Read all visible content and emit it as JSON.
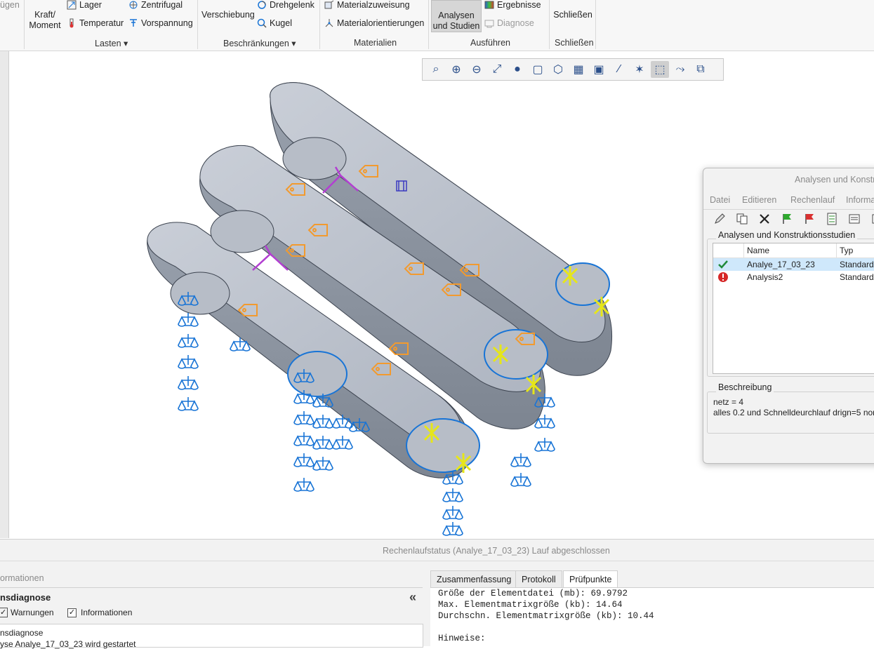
{
  "ribbon": {
    "partial_left_label": "ügen",
    "loads": {
      "force_label": "Kraft/\nMoment",
      "bearing_label": "Lager",
      "temperature_label": "Temperatur",
      "centrifugal_label": "Zentrifugal",
      "preload_label": "Vorspannung",
      "group_label": "Lasten"
    },
    "constraints": {
      "displacement_label": "Verschiebung",
      "pin_label": "Drehgelenk",
      "ball_label": "Kugel",
      "group_label": "Beschränkungen"
    },
    "materials": {
      "assignment_label": "Materialzuweisung",
      "orientations_label": "Materialorientierungen",
      "group_label": "Materialien"
    },
    "run": {
      "analyses_label": "Analysen\nund Studien",
      "results_label": "Ergebnisse",
      "diagnosis_label": "Diagnose",
      "group_label": "Ausführen"
    },
    "close": {
      "close_label": "Schließen",
      "group_label": "Schließen"
    }
  },
  "view_toolbar": {
    "icons": [
      "zoom-window-icon",
      "zoom-in-icon",
      "zoom-out-icon",
      "refit-icon",
      "shading-icon",
      "saved-views-icon",
      "view-manager-icon",
      "perspective-icon",
      "display-style-icon",
      "datum-display-icon",
      "annotation-display-icon",
      "simulation-display-icon",
      "spin-center-icon",
      "appearance-icon"
    ],
    "active_index": 11
  },
  "dialog": {
    "title": "Analysen und Konstr",
    "menu": [
      "Datei",
      "Editieren",
      "Rechenlauf",
      "Informa"
    ],
    "tools": [
      "edit-icon",
      "copy-icon",
      "delete-icon",
      "start-flag-icon",
      "stop-flag-icon",
      "checklist-icon",
      "info-icon",
      "more-icon"
    ],
    "list_legend": "Analysen und Konstruktionsstudien",
    "columns": {
      "name": "Name",
      "type": "Typ"
    },
    "rows": [
      {
        "name": "Analye_17_03_23",
        "type": "Standard/",
        "status": "ok"
      },
      {
        "name": "Analysis2",
        "type": "Standard/",
        "status": "error"
      }
    ],
    "description_legend": "Beschreibung",
    "description_lines": [
      "netz = 4",
      "alles 0.2 und Schnelldeurchlauf drign=5 nor"
    ]
  },
  "bottom": {
    "status_title": "Rechenlaufstatus (Analye_17_03_23) Lauf abgeschlossen",
    "left_header": "ormationen",
    "diag_title": "nsdiagnose",
    "warnings_label": "Warnungen",
    "info_label": "Informationen",
    "diag_line1": "nsdiagnose",
    "diag_line2": "yse Analye_17_03_23 wird gestartet",
    "tabs": [
      "Zusammenfassung",
      "Protokoll",
      "Prüfpunkte"
    ],
    "active_tab": 2,
    "log_lines": [
      "Größe der Elementdatei (mb): 69.9792",
      "Max. Elementmatrixgröße (kb): 14.64",
      "Durchschn. Elementmatrixgröße (kb): 10.44",
      "",
      "Hinweise:"
    ]
  },
  "colors": {
    "model": "#bfc6d0",
    "model_edge": "#3d4450",
    "constraint": "#1874d6",
    "load": "#f29a2e",
    "pin": "#e6e619",
    "purple": "#b23fd1",
    "selection": "#cfe8fb"
  }
}
